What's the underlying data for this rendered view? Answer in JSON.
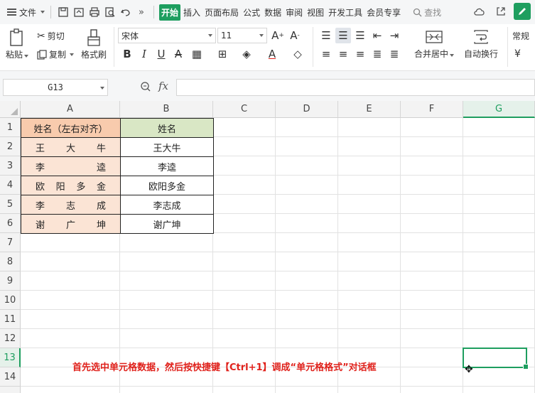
{
  "menubar": {
    "file_label": "文件",
    "tabs": [
      "开始",
      "插入",
      "页面布局",
      "公式",
      "数据",
      "审阅",
      "视图",
      "开发工具",
      "会员专享"
    ],
    "active_tab": "开始",
    "search_label": "查找"
  },
  "ribbon": {
    "paste": "粘贴",
    "cut": "剪切",
    "copy": "复制",
    "format_painter": "格式刷",
    "font_name": "宋体",
    "font_size": "11",
    "merge_center": "合并居中",
    "wrap_text": "自动换行",
    "number_format": "常规",
    "currency_symbol": "¥"
  },
  "formula_bar": {
    "name_box": "G13",
    "fx": "fx",
    "formula": ""
  },
  "grid": {
    "columns": [
      "A",
      "B",
      "C",
      "D",
      "E",
      "F",
      "G"
    ],
    "selected_column": "G",
    "rows": [
      "1",
      "2",
      "3",
      "4",
      "5",
      "6",
      "7",
      "8",
      "9",
      "10",
      "11",
      "12",
      "13",
      "14"
    ],
    "selected_row": "13",
    "colA_header": "姓名（左右对齐）",
    "colB_header": "姓名",
    "colA_values": [
      [
        "王",
        "大",
        "牛"
      ],
      [
        "李",
        "逵"
      ],
      [
        "欧",
        "阳",
        "多",
        "金"
      ],
      [
        "李",
        "志",
        "成"
      ],
      [
        "谢",
        "广",
        "坤"
      ]
    ],
    "colB_values": [
      "王大牛",
      "李逵",
      "欧阳多金",
      "李志成",
      "谢广坤"
    ]
  },
  "caption": "首先选中单元格数据，然后按快捷键【Ctrl+1】调成“单元格格式”对话框",
  "colors": {
    "accent": "#1e9e5f",
    "header_a": "#f8cbad",
    "fill_a": "#fbe4d5",
    "header_b": "#d9e7c5",
    "caption": "#e0211b"
  }
}
